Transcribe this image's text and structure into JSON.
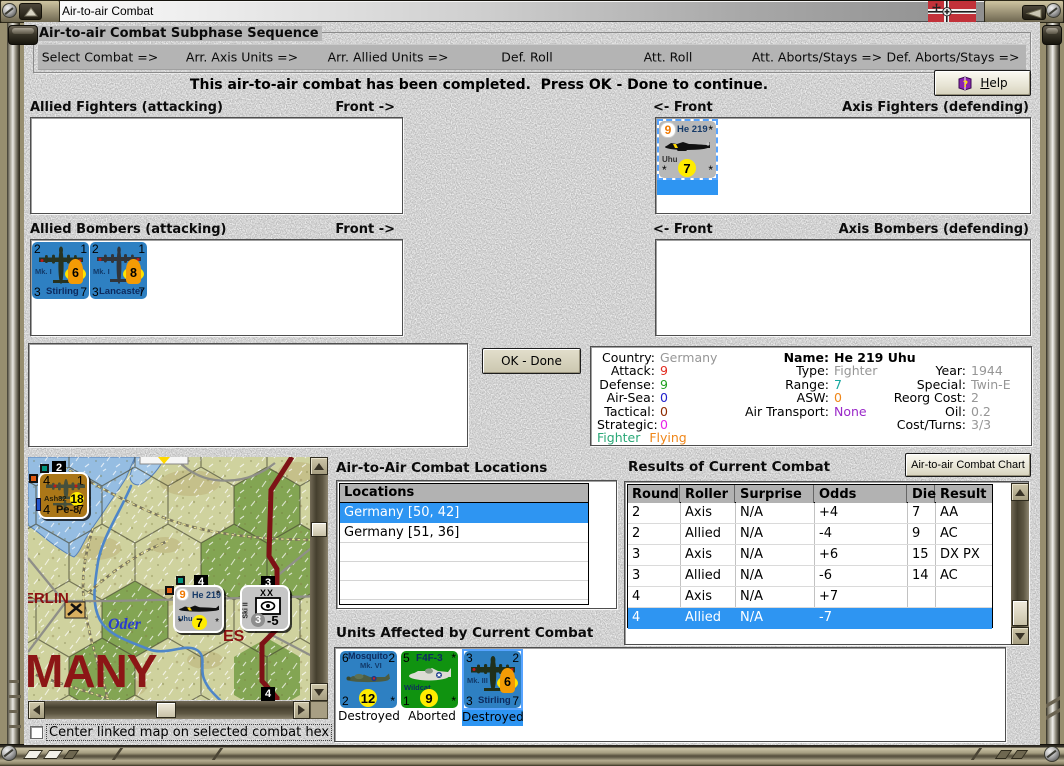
{
  "window": {
    "title": "Air-to-air Combat"
  },
  "sequence": {
    "title": "Air-to-air Combat Subphase Sequence",
    "phases": {
      "p0": "Select Combat =>",
      "p1": "Arr. Axis Units =>",
      "p2": "Arr. Allied Units =>",
      "p3": "Def. Roll",
      "p4": "Att. Roll",
      "p5": "Att. Aborts/Stays =>",
      "p6": "Def. Aborts/Stays =>"
    }
  },
  "status_message": "This air-to-air combat has been completed.  Press OK - Done to continue.",
  "help_button": "Help",
  "ok_button": "OK - Done",
  "chart_button": "Air-to-air Combat Chart",
  "section_labels": {
    "allied_fighters": "Allied Fighters (attacking)",
    "allied_bombers": "Allied Bombers (attacking)",
    "axis_fighters": "Axis Fighters (defending)",
    "axis_bombers": "Axis Bombers (defending)",
    "front_right": "Front ->",
    "front_left": "<- Front"
  },
  "unit_info": {
    "country_label": "Country:",
    "country": "Germany",
    "attack_label": "Attack:",
    "attack": "9",
    "defense_label": "Defense:",
    "defense": "9",
    "airsea_label": "Air-Sea:",
    "airsea": "0",
    "tactical_label": "Tactical:",
    "tactical": "0",
    "strategic_label": "Strategic:",
    "strategic": "0",
    "name_label": "Name:",
    "name": "He 219 Uhu",
    "type_label": "Type:",
    "type": "Fighter",
    "range_label": "Range:",
    "range": "7",
    "asw_label": "ASW:",
    "asw": "0",
    "airtransport_label": "Air Transport:",
    "airtransport": "None",
    "year_label": "Year:",
    "year": "1944",
    "special_label": "Special:",
    "special": "Twin-E",
    "reorg_label": "Reorg Cost:",
    "reorg": "2",
    "oil_label": "Oil:",
    "oil": "0.2",
    "costturns_label": "Cost/Turns:",
    "costturns": "3/3",
    "status_fighter": "Fighter",
    "status_flying": "Flying"
  },
  "locations": {
    "title": "Air-to-Air Combat Locations",
    "header": "Locations",
    "rows": {
      "r0": "Germany [50, 42]",
      "r1": "Germany [51, 36]"
    },
    "selected_index": 0
  },
  "results": {
    "title": "Results of Current Combat",
    "headers": {
      "h0": "Round",
      "h1": "Roller",
      "h2": "Surprise",
      "h3": "Odds",
      "h4": "Die",
      "h5": "Result"
    },
    "rows": [
      [
        "2",
        "Axis",
        "N/A",
        "+4",
        "7",
        "AA"
      ],
      [
        "2",
        "Allied",
        "N/A",
        "-4",
        "9",
        "AC"
      ],
      [
        "3",
        "Axis",
        "N/A",
        "+6",
        "15",
        "DX PX"
      ],
      [
        "3",
        "Allied",
        "N/A",
        "-6",
        "14",
        "AC"
      ],
      [
        "4",
        "Axis",
        "N/A",
        "+7",
        "",
        ""
      ],
      [
        "4",
        "Allied",
        "N/A",
        "-7",
        "",
        ""
      ]
    ],
    "selected_index": 5
  },
  "units_affected": {
    "title": "Units Affected by Current Combat",
    "mosquito": {
      "tl": "6",
      "name": "Mosquito",
      "sub": "Mk. VI",
      "tr": "2",
      "bl": "2",
      "badge": "12",
      "br": "*",
      "caption": "Destroyed"
    },
    "f4f": {
      "tl": "5",
      "name": "F4F-3",
      "sub": "Wildcat",
      "tr": "*",
      "bl": "1",
      "badge": "9",
      "br": "*",
      "caption": "Aborted"
    },
    "stirling3": {
      "tl": "3",
      "tr": "2",
      "sub": "Mk. III",
      "bl": "3",
      "name": "Stirling",
      "br": "7",
      "badge": "6",
      "caption": "Destroyed"
    }
  },
  "counters": {
    "he219": {
      "tl": "9",
      "name": "He 219",
      "tr": "*",
      "sub": "Uhu",
      "bl": "*",
      "badge": "7",
      "br": "*"
    },
    "stirling": {
      "tl": "2",
      "tr": "1",
      "sub": "Mk. I",
      "bl": "3",
      "name": "Stirling",
      "br": "7",
      "badge": "6"
    },
    "lancaster": {
      "tl": "2",
      "tr": "1",
      "sub": "Mk. I",
      "bl": "3",
      "name": "Lancaster",
      "br": "7",
      "badge": "8"
    },
    "pe8": {
      "tl": "4",
      "tr": "1",
      "sub": "Ash82",
      "badge": "18",
      "bl": "4",
      "name": "Pe-8",
      "br": "7"
    },
    "division": {
      "top": "XX",
      "side": "Ski II",
      "strength": "3",
      "dash": "-5"
    }
  },
  "map": {
    "checkbox_label": "Center linked map on selected combat hex",
    "checked": false,
    "city": "BERLIN",
    "river": "Oder",
    "country_text": "MANY",
    "city2": "ES",
    "hex_numbers": {
      "n0": "2",
      "n1": "4",
      "n2": "3",
      "n3": "4"
    }
  },
  "colors": {
    "selection_blue": "#2e95f2",
    "allied_counter_blue": "#2e80c2",
    "axis_counter_gray": "#b8b8b8",
    "f4f_green": "#109310",
    "pe8_orange": "#bd7e00",
    "front_line_red": "#7d1216",
    "map_land": "#cdd1a3",
    "attack_red": "#e22a1e",
    "defense_green": "#1fa01f"
  }
}
